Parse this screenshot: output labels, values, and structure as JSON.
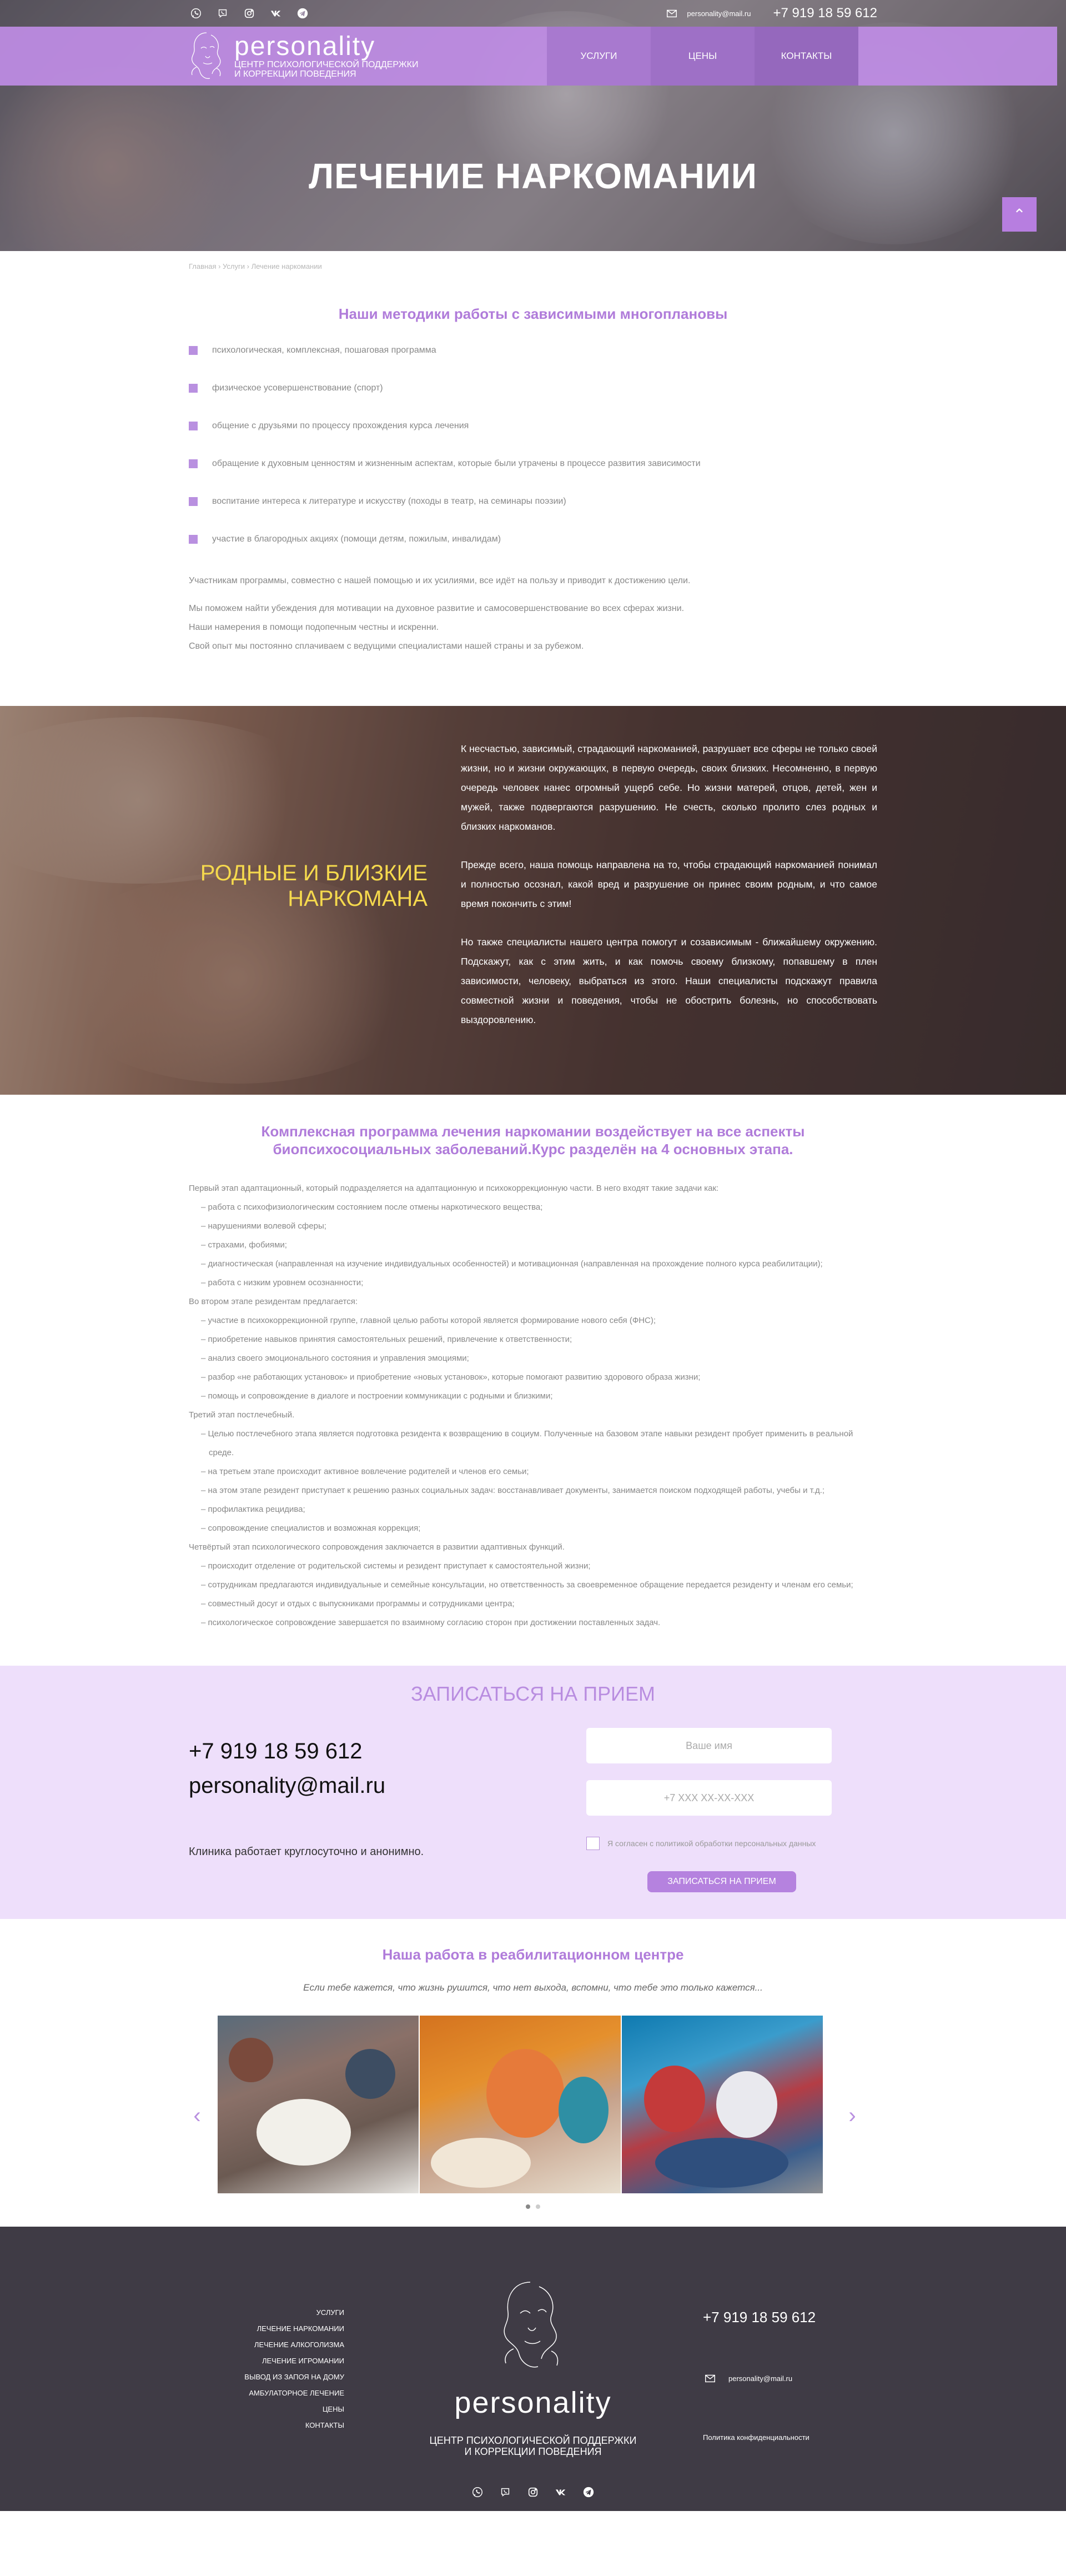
{
  "header": {
    "email": "personality@mail.ru",
    "phone": "+7 919 18 59 612",
    "logo_name": "personality",
    "logo_sub1": "ЦЕНТР ПСИХОЛОГИЧЕСКОЙ ПОДДЕРЖКИ",
    "logo_sub2": "И КОРРЕКЦИИ ПОВЕДЕНИЯ",
    "nav": [
      "УСЛУГИ",
      "ЦЕНЫ",
      "КОНТАКТЫ"
    ],
    "social_icons": [
      "whatsapp-icon",
      "viber-icon",
      "instagram-icon",
      "vk-icon",
      "telegram-icon"
    ]
  },
  "hero": {
    "title": "ЛЕЧЕНИЕ НАРКОМАНИИ"
  },
  "breadcrumb": "Главная › Услуги › Лечение наркомании",
  "methods": {
    "title": "Наши методики работы с зависимыми многоплановы",
    "items": [
      "психологическая, комплексная, пошаговая программа",
      "физическое усовершенствование (спорт)",
      "общение с друзьями по процессу прохождения курса лечения",
      "обращение к духовным ценностям и жизненным аспектам, которые были утрачены в процессе развития зависимости",
      "воспитание интереса к литературе и искусству (походы в театр, на семинары поэзии)",
      "участие в благородных акциях (помощи детям, пожилым, инвалидам)"
    ],
    "p1": "Участникам программы, совместно с нашей помощью и их усилиями, все идёт на пользу и приводит к достижению цели.",
    "p2": "Мы поможем найти убеждения для мотивации на духовное развитие и самосовершенствование во всех сферах жизни.",
    "p3": "Наши намерения в помощи подопечным честны и искренни.",
    "p4": "Свой опыт мы постоянно сплачиваем с ведущими специалистами нашей страны и за рубежом."
  },
  "relatives": {
    "title": "РОДНЫЕ И БЛИЗКИЕ НАРКОМАНА",
    "p1": "К несчастью, зависимый, страдающий наркоманией, разрушает все сферы не только своей жизни, но и жизни окружающих, в первую очередь, своих близких. Несомненно, в первую очередь человек нанес огромный ущерб себе. Но жизни матерей, отцов, детей, жен и мужей, также подвергаются разрушению. Не счесть, сколько пролито слез родных и близких наркоманов.",
    "p2": "Прежде всего, наша помощь направлена на то, чтобы страдающий наркоманией понимал и полностью осознал, какой вред и разрушение он принес своим родным, и что самое время покончить с этим!",
    "p3": "Но также специалисты нашего центра помогут и созависимым - ближайшему окружению. Подскажут, как с этим жить, и как помочь своему близкому, попавшему в плен зависимости, человеку, выбраться из этого. Наши специалисты подскажут правила совместной жизни и поведения, чтобы не обострить болезнь, но способствовать выздоровлению."
  },
  "program": {
    "title1": "Комплексная программа лечения наркомании воздействует на все аспекты",
    "title2": "биопсихосоциальных заболеваний.Курс разделён на 4 основных этапа.",
    "lines": [
      {
        "t": "Первый этап адаптационный, который подразделяется на адаптационную и психокоррекционную части. В него входят такие задачи как:",
        "sub": false
      },
      {
        "t": "работа с психофизиологическим состоянием после отмены наркотического вещества;",
        "sub": true
      },
      {
        "t": "нарушениями волевой сферы;",
        "sub": true
      },
      {
        "t": "страхами, фобиями;",
        "sub": true
      },
      {
        "t": "диагностическая (направленная на изучение индивидуальных особенностей) и мотивационная (направленная на прохождение полного курса реабилитации);",
        "sub": true
      },
      {
        "t": "работа с низким уровнем осознанности;",
        "sub": true
      },
      {
        "t": "Во втором этапе резидентам предлагается:",
        "sub": false
      },
      {
        "t": "участие в психокоррекционной группе, главной целью работы которой является формирование нового себя (ФНС);",
        "sub": true
      },
      {
        "t": "приобретение навыков принятия самостоятельных решений, привлечение к ответственности;",
        "sub": true
      },
      {
        "t": "анализ своего эмоционального состояния и управления эмоциями;",
        "sub": true
      },
      {
        "t": "разбор «не работающих установок» и приобретение «новых установок», которые помогают развитию здорового образа жизни;",
        "sub": true
      },
      {
        "t": "помощь и сопровождение в диалоге и построении коммуникации с родными и близкими;",
        "sub": true
      },
      {
        "t": "Третий этап постлечебный.",
        "sub": false
      },
      {
        "t": "Целью постлечебного этапа является подготовка резидента к возвращению в социум. Полученные на базовом этапе навыки резидент пробует применить в реальной среде.",
        "sub": true
      },
      {
        "t": "на третьем этапе происходит активное вовлечение родителей и членов его семьи;",
        "sub": true
      },
      {
        "t": "на этом этапе резидент приступает к решению разных социальных задач: восстанавливает документы, занимается поиском подходящей работы, учебы и т.д.;",
        "sub": true
      },
      {
        "t": "профилактика рецидива;",
        "sub": true
      },
      {
        "t": "сопровождение специалистов и возможная коррекция;",
        "sub": true
      },
      {
        "t": "Четвёртый этап психологического сопровождения заключается в развитии адаптивных функций.",
        "sub": false
      },
      {
        "t": "происходит отделение от родительской системы и резидент приступает к самостоятельной жизни;",
        "sub": true
      },
      {
        "t": "сотрудникам предлагаются индивидуальные и семейные консультации, но ответственность за своевременное обращение передается резиденту и членам его семьи;",
        "sub": true
      },
      {
        "t": "совместный досуг и отдых с выпускниками программы и сотрудниками центра;",
        "sub": true
      },
      {
        "t": "психологическое сопровождение завершается по взаимному согласию сторон при достижении поставленных задач.",
        "sub": true
      }
    ]
  },
  "appointment": {
    "title": "ЗАПИСАТЬСЯ НА ПРИЕМ",
    "phone": "+7 919 18 59 612",
    "email": "personality@mail.ru",
    "note": "Клиника работает круглосуточно и анонимно.",
    "name_placeholder": "Ваше имя",
    "phone_placeholder": "+7 XXX XX-XX-XXX",
    "agree": "Я согласен с политикой обработки персональных данных",
    "submit": "ЗАПИСАТЬСЯ НА ПРИЕМ"
  },
  "gallery": {
    "title": "Наша работа в реабилитационном центре",
    "subtitle": "Если тебе кажется, что жизнь рушится, что нет выхода, вспомни, что тебе это только кажется..."
  },
  "footer": {
    "menu": [
      "УСЛУГИ",
      "ЛЕЧЕНИЕ НАРКОМАНИИ",
      "ЛЕЧЕНИЕ АЛКОГОЛИЗМА",
      "ЛЕЧЕНИЕ ИГРОМАНИИ",
      "ВЫВОД ИЗ ЗАПОЯ НА ДОМУ",
      "АМБУЛАТОРНОЕ ЛЕЧЕНИЕ",
      "ЦЕНЫ",
      "КОНТАКТЫ"
    ],
    "name": "personality",
    "sub1": "ЦЕНТР ПСИХОЛОГИЧЕСКОЙ ПОДДЕРЖКИ",
    "sub2": "И КОРРЕКЦИИ ПОВЕДЕНИЯ",
    "phone": "+7 919 18 59 612",
    "email": "personality@mail.ru",
    "policy": "Политика конфиденциальности"
  },
  "colors": {
    "accent": "#b07cda",
    "nav": "#be8ce4",
    "footer": "#3f3b45",
    "yellow": "#f5d94d"
  }
}
